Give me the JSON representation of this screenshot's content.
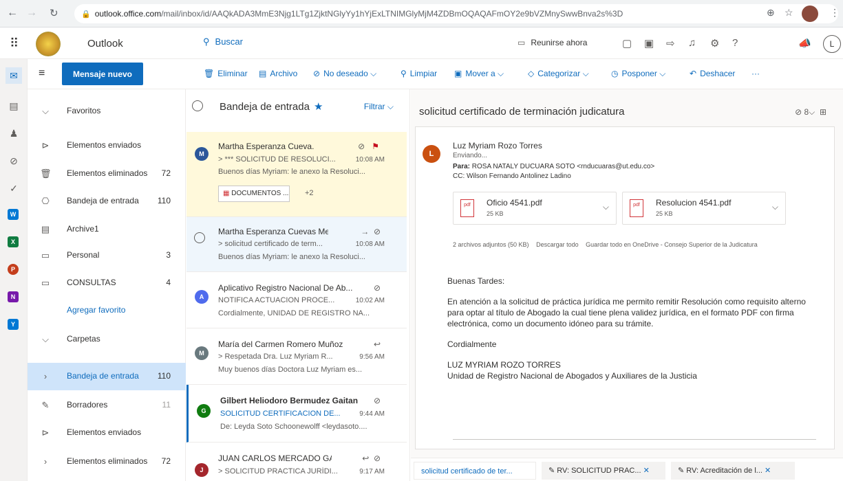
{
  "browser": {
    "url_host": "outlook.office.com",
    "url_path": "/mail/inbox/id/AAQkADA3MmE3Njg1LTg1ZjktNGlyYy1hYjExLTNIMGlyMjM4ZDBmOQAQAFmOY2e9bVZMnySwwBnva2s%3D"
  },
  "header": {
    "app_name": "Outlook",
    "search_placeholder": "Buscar",
    "meet_now": "Reunirse ahora",
    "user_initial": "L"
  },
  "command_bar": {
    "new_message": "Mensaje nuevo",
    "delete": "Eliminar",
    "archive": "Archivo",
    "junk": "No deseado",
    "sweep": "Limpiar",
    "move": "Mover a",
    "categorize": "Categorizar",
    "snooze": "Posponer",
    "undo": "Deshacer",
    "more": "···"
  },
  "folders": {
    "favorites_label": "Favoritos",
    "sent": "Elementos enviados",
    "deleted": "Elementos eliminados",
    "deleted_count": "72",
    "inbox": "Bandeja de entrada",
    "inbox_count": "110",
    "archive1": "Archive1",
    "personal": "Personal",
    "personal_count": "3",
    "consultas": "CONSULTAS",
    "consultas_count": "4",
    "add_favorite": "Agregar favorito",
    "folders_label": "Carpetas",
    "f_inbox": "Bandeja de entrada",
    "f_inbox_count": "110",
    "drafts": "Borradores",
    "drafts_count": "11",
    "f_sent": "Elementos enviados",
    "f_deleted": "Elementos eliminados",
    "f_deleted_count": "72"
  },
  "list": {
    "title": "Bandeja de entrada",
    "filter": "Filtrar",
    "messages": [
      {
        "initial": "M",
        "color": "#2b579a",
        "sender": "Martha Esperanza Cueva...",
        "subject": "> *** SOLICITUD DE RESOLUCI...",
        "time": "10:08 AM",
        "preview": "Buenos días Myriam: le anexo la Resoluci...",
        "chip": "DOCUMENTOS ...",
        "chip_more": "+2"
      },
      {
        "initial": "",
        "color": "",
        "sender": "Martha Esperanza Cuevas Mel...",
        "subject": "> solicitud certificado de term...",
        "time": "10:08 AM",
        "preview": "Buenos días Myriam: le anexo la Resoluci..."
      },
      {
        "initial": "A",
        "color": "#4f6bed",
        "sender": "Aplicativo Registro Nacional De Ab...",
        "subject": "NOTIFICA ACTUACION PROCE...",
        "time": "10:02 AM",
        "preview": "Cordialmente, UNIDAD DE REGISTRO NA..."
      },
      {
        "initial": "M",
        "color": "#69797e",
        "sender": "María del Carmen Romero Muñoz",
        "subject": "> Respetada Dra. Luz Myriam R...",
        "time": "9:56 AM",
        "preview": "Muy buenos días Doctora Luz Myriam es..."
      },
      {
        "initial": "G",
        "color": "#107c10",
        "sender": "Gilbert Heliodoro Bermudez Gaitan",
        "subject": "SOLICITUD CERTIFICACION DE...",
        "time": "9:44 AM",
        "preview": "De: Leyda Soto Schoonewolff <leydasoto...."
      },
      {
        "initial": "J",
        "color": "#a4262c",
        "sender": "JUAN CARLOS MERCADO GA...",
        "subject": "> SOLICITUD PRACTICA JURÍDI...",
        "time": "9:17 AM",
        "preview": ""
      }
    ]
  },
  "reading": {
    "subject": "solicitud certificado de terminación judicatura",
    "count": "8",
    "sender_initial": "L",
    "from": "Luz Myriam Rozo Torres",
    "status": "Enviando...",
    "to_label": "Para:",
    "to": "ROSA NATALY DUCUARA SOTO <rnducuaras@ut.edu.co>",
    "cc_label": "CC:",
    "cc": "Wilson Fernando Antolinez Ladino",
    "attachments": [
      {
        "name": "Oficio 4541.pdf",
        "size": "25 KB"
      },
      {
        "name": "Resolucion 4541.pdf",
        "size": "25 KB"
      }
    ],
    "att_summary": "2 archivos adjuntos (50 KB)",
    "download_all": "Descargar todo",
    "save_onedrive": "Guardar todo en OneDrive - Consejo Superior de la Judicatura",
    "greeting": "Buenas Tardes:",
    "paragraph": "En atención a la solicitud de práctica jurídica me permito remitir Resolución como requisito alterno para optar al título de Abogado la cual tiene plena validez jurídica, en el formato PDF con firma electrónica, como un documento idóneo para su trámite.",
    "closing": "Cordialmente",
    "signature_name": "LUZ MYRIAM ROZO TORRES",
    "signature_unit": "Unidad de Registro Nacional de Abogados y Auxiliares de la Justicia"
  },
  "tabs": [
    {
      "label": "solicitud certificado de ter..."
    },
    {
      "label": "RV: SOLICITUD PRAC..."
    },
    {
      "label": "RV: Acreditación de l..."
    }
  ],
  "colors": {
    "accent": "#0f6cbd",
    "flag": "#c50f1f",
    "selected": "#cfe4fa",
    "highlight": "#fff9db"
  }
}
